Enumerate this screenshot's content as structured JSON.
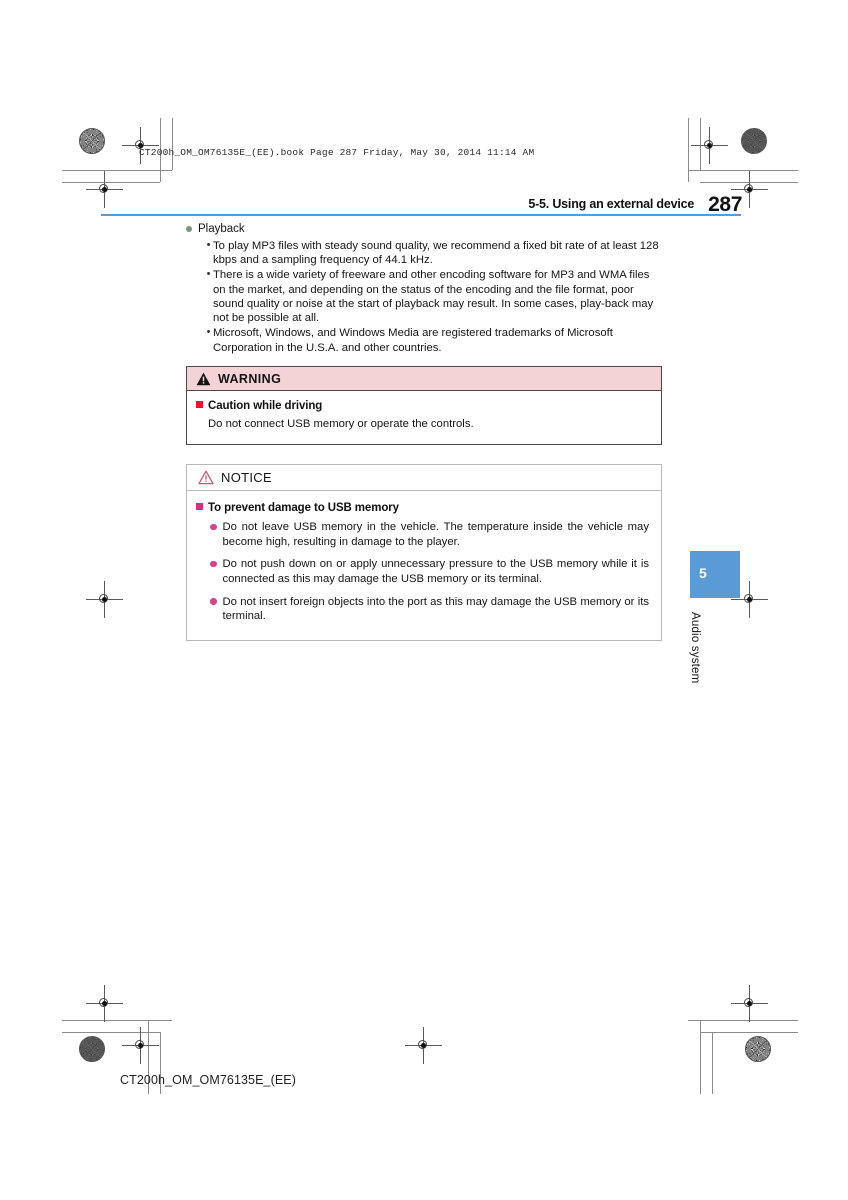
{
  "document": {
    "file_stamp": "CT200h_OM_OM76135E_(EE).book  Page 287  Friday, May 30, 2014  11:14 AM",
    "footer_code": "CT200h_OM_OM76135E_(EE)"
  },
  "header": {
    "section": "5-5. Using an external device",
    "page_number": "287",
    "rule_color": "#5b9bd5"
  },
  "side_tab": {
    "chapter_number": "5",
    "chapter_label": "Audio system",
    "tab_color": "#5b9bd5"
  },
  "body": {
    "heading": "Playback",
    "bullets": [
      "To play MP3 files with steady sound quality, we recommend a fixed bit rate of at least 128 kbps and a sampling frequency of 44.1 kHz.",
      "There is a wide variety of freeware and other encoding software for MP3 and WMA files on the market, and depending on the status of the encoding and the file format, poor sound quality or noise at the start of playback may result. In some cases, play-back may not be possible at all.",
      "Microsoft, Windows, and Windows Media are registered trademarks of Microsoft Corporation in the U.S.A. and other countries."
    ],
    "bullet_marker": "•",
    "heading_dot_color": "#7e9384"
  },
  "warning_box": {
    "title": "WARNING",
    "header_bg": "#f3d3d6",
    "marker_color": "#e8162a",
    "subheading": "Caution while driving",
    "text": "Do not connect USB memory or operate the controls."
  },
  "notice_box": {
    "title": "NOTICE",
    "triangle_color": "#c75a6e",
    "marker_color": "#d62f7e",
    "subheading": "To prevent damage to USB memory",
    "items": [
      "Do not leave USB memory in the vehicle. The temperature inside the vehicle may become high, resulting in damage to the player.",
      "Do not push down on or apply unnecessary pressure to the USB memory while it is connected as this may damage the USB memory or its terminal.",
      "Do not insert foreign objects into the port as this may damage the USB memory or its terminal."
    ]
  }
}
